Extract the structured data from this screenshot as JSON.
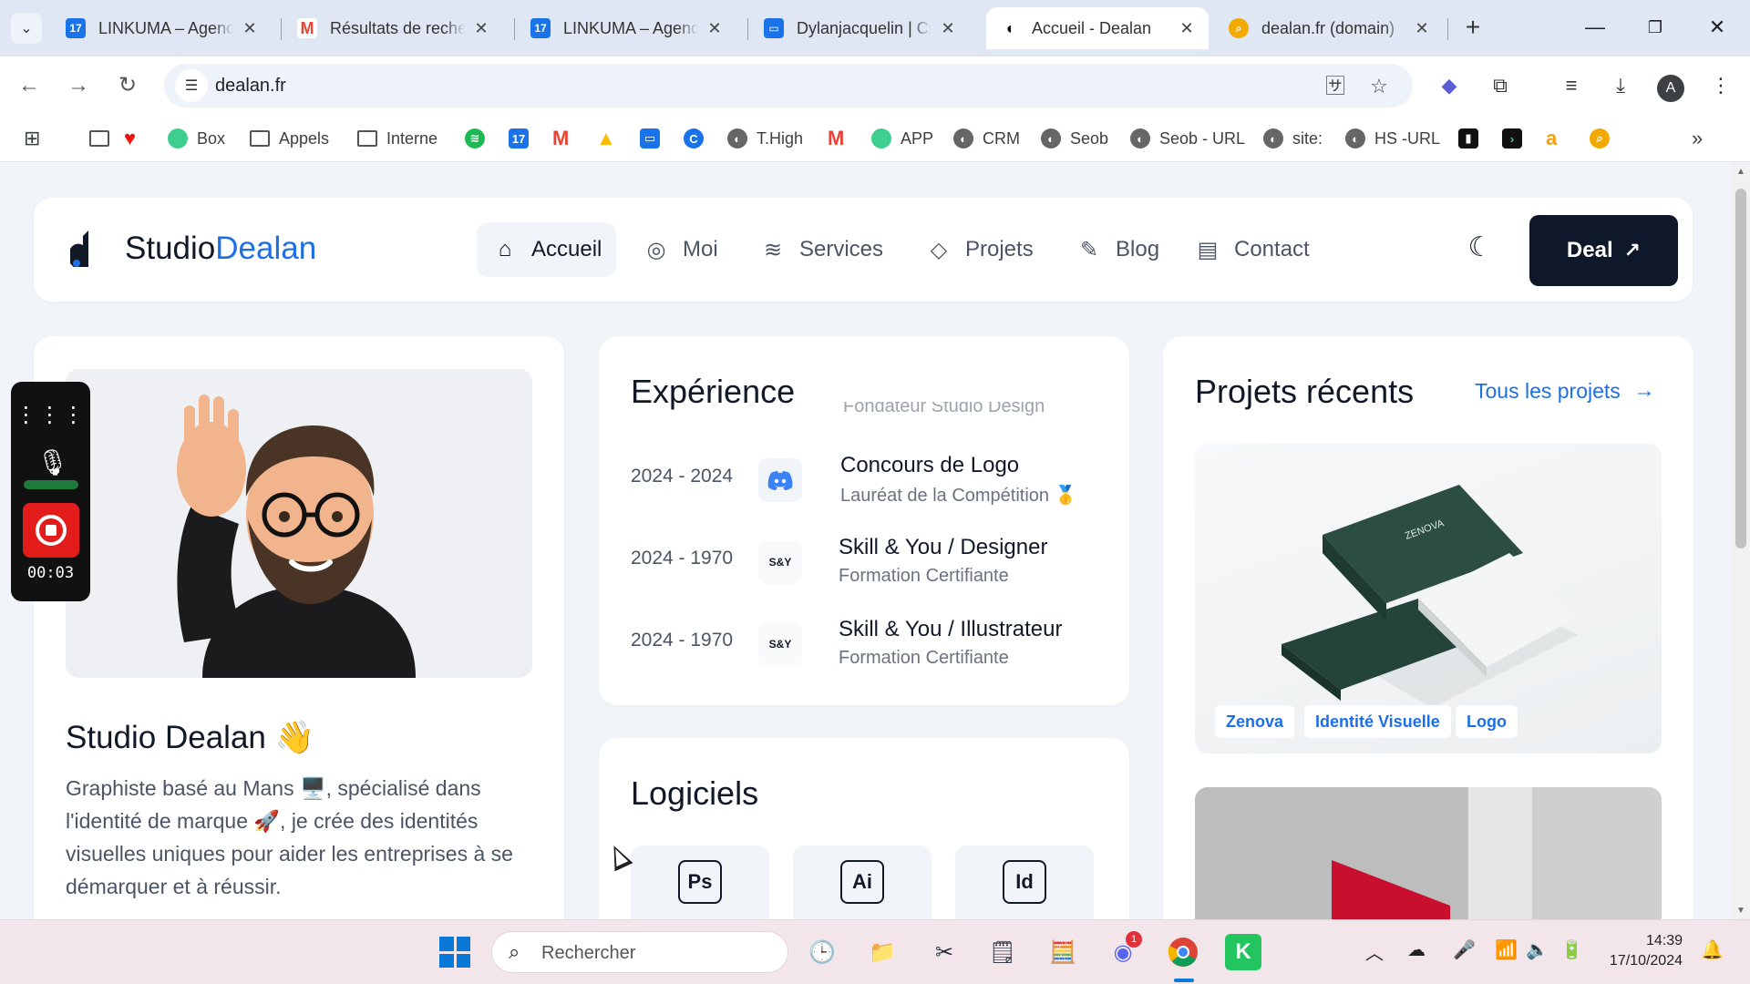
{
  "browser": {
    "tabs": [
      {
        "title": "LINKUMA – Agenda",
        "favicon": "calendar-icon",
        "color": "#1a73e8"
      },
      {
        "title": "Résultats de recherche",
        "favicon": "gmail-icon",
        "color": "#ea4335"
      },
      {
        "title": "LINKUMA – Agenda",
        "favicon": "calendar-icon",
        "color": "#1a73e8"
      },
      {
        "title": "Dylanjacquelin | Cr",
        "favicon": "chat-icon",
        "color": "#1a73e8"
      },
      {
        "title": "Accueil - Dealan",
        "favicon": "dealan-icon",
        "color": "#111827"
      },
      {
        "title": "dealan.fr (domain)",
        "favicon": "magnify-icon",
        "color": "#f2a900"
      }
    ],
    "active_tab_index": 4,
    "url": "dealan.fr",
    "profile_initial": "A",
    "bookmarks": [
      "Box",
      "Appels",
      "Interne",
      "T.High",
      "APP",
      "CRM",
      "Seob",
      "Seob - URL",
      "site:",
      "HS -URL"
    ]
  },
  "site": {
    "logo_text_main": "Studio",
    "logo_text_accent": "Dealan",
    "nav": [
      {
        "label": "Accueil",
        "icon": "home-icon"
      },
      {
        "label": "Moi",
        "icon": "user-icon"
      },
      {
        "label": "Services",
        "icon": "layers-icon"
      },
      {
        "label": "Projets",
        "icon": "palette-icon"
      },
      {
        "label": "Blog",
        "icon": "pen-icon"
      },
      {
        "label": "Contact",
        "icon": "message-icon"
      }
    ],
    "active_nav_index": 0,
    "cta_label": "Deal",
    "accent_color": "#1d6fe6"
  },
  "profile": {
    "name": "Studio Dealan 👋",
    "bio": "Graphiste basé au Mans 🖥️, spécialisé dans l'identité de marque 🚀, je crée des identités visuelles uniques pour aider les entreprises à se démarquer et à réussir."
  },
  "experience": {
    "title": "Expérience",
    "ghost_text": "Fondateur Studio Design",
    "items": [
      {
        "years": "2024 - 2024",
        "title": "Concours de Logo",
        "subtitle": "Lauréat de la Compétition 🥇",
        "logo": "discord-icon"
      },
      {
        "years": "2024 - 1970",
        "title": "Skill & You / Designer",
        "subtitle": "Formation Certifiante",
        "logo": "S&Y"
      },
      {
        "years": "2024 - 1970",
        "title": "Skill & You / Illustrateur",
        "subtitle": "Formation Certifiante",
        "logo": "S&Y"
      }
    ]
  },
  "software": {
    "title": "Logiciels",
    "items": [
      "Ps",
      "Ai",
      "Id"
    ]
  },
  "projects": {
    "title": "Projets récents",
    "all_link": "Tous les projets",
    "featured_tags": [
      "Zenova",
      "Identité Visuelle",
      "Logo"
    ]
  },
  "recorder": {
    "time": "00:03"
  },
  "taskbar": {
    "search_placeholder": "Rechercher",
    "time": "14:39",
    "date": "17/10/2024",
    "discord_badge": "1"
  }
}
